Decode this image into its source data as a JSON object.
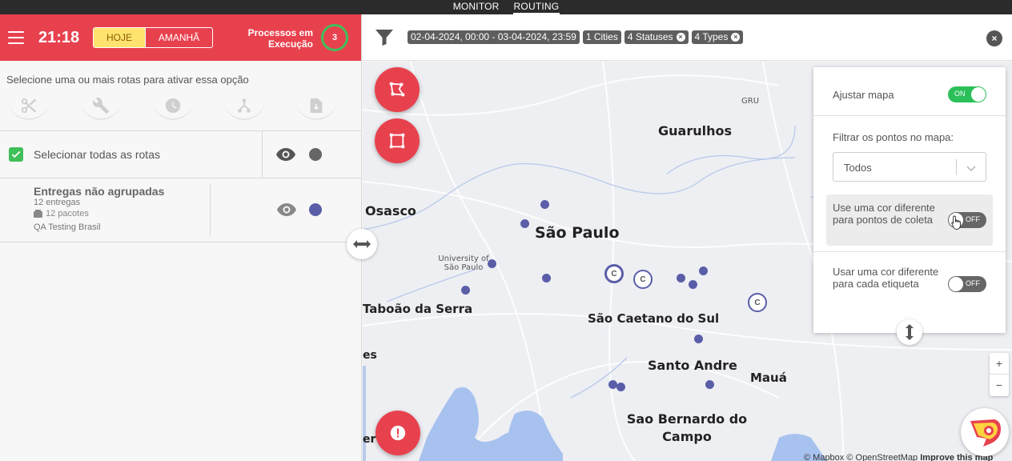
{
  "topnav": {
    "items": [
      "MONITOR",
      "ROUTING"
    ],
    "active": "ROUTING"
  },
  "header": {
    "time": "21:18",
    "today_label": "HOJE",
    "tomorrow_label": "AMANHÃ",
    "processes_label": "Processos em Execução",
    "processes_count": "3"
  },
  "panel": {
    "hint": "Selecione uma ou mais rotas para ativar essa opção",
    "tools": [
      "scissors-icon",
      "wrench-icon",
      "clock-icon",
      "route-icon",
      "download-icon"
    ],
    "select_all_label": "Selecionar todas as rotas",
    "route": {
      "title": "Entregas não agrupadas",
      "deliveries": "12 entregas",
      "packages": "12 pacotes",
      "company": "QA Testing Brasil"
    }
  },
  "filters": {
    "chips": [
      "02-04-2024, 00:00 - 03-04-2024, 23:59",
      "1 Cities",
      "4 Statuses",
      "4 Types"
    ]
  },
  "map": {
    "labels": {
      "gru": "GRU",
      "guarulhos": "Guarulhos",
      "osasco": "Osasco",
      "sao_paulo": "São Paulo",
      "usp": "University of São Paulo",
      "taboao": "Taboão da Serra",
      "sao_caetano": "São Caetano do Sul",
      "santo_andre": "Santo Andre",
      "maua": "Mauá",
      "sao_bernardo": "Sao Bernardo do Campo",
      "es": "es",
      "er": "er"
    },
    "collect_marker_label": "C",
    "attribution_a": "© Mapbox © OpenStreetMap",
    "attribution_b": "Improve this map",
    "zoom_in": "+",
    "zoom_out": "−"
  },
  "settings": {
    "adjust_map_label": "Ajustar mapa",
    "adjust_map_state": "ON",
    "filter_points_label": "Filtrar os pontos no mapa:",
    "filter_value": "Todos",
    "collect_color_label": "Use uma cor diferente para pontos de coleta",
    "collect_color_state": "OFF",
    "tag_color_label": "Usar uma cor diferente para cada etiqueta",
    "tag_color_state": "OFF"
  },
  "colors": {
    "brand": "#e8414e",
    "accent_green": "#2bbf59",
    "route_dot": "#5a5ea8",
    "highlight": "#ffe36e"
  }
}
